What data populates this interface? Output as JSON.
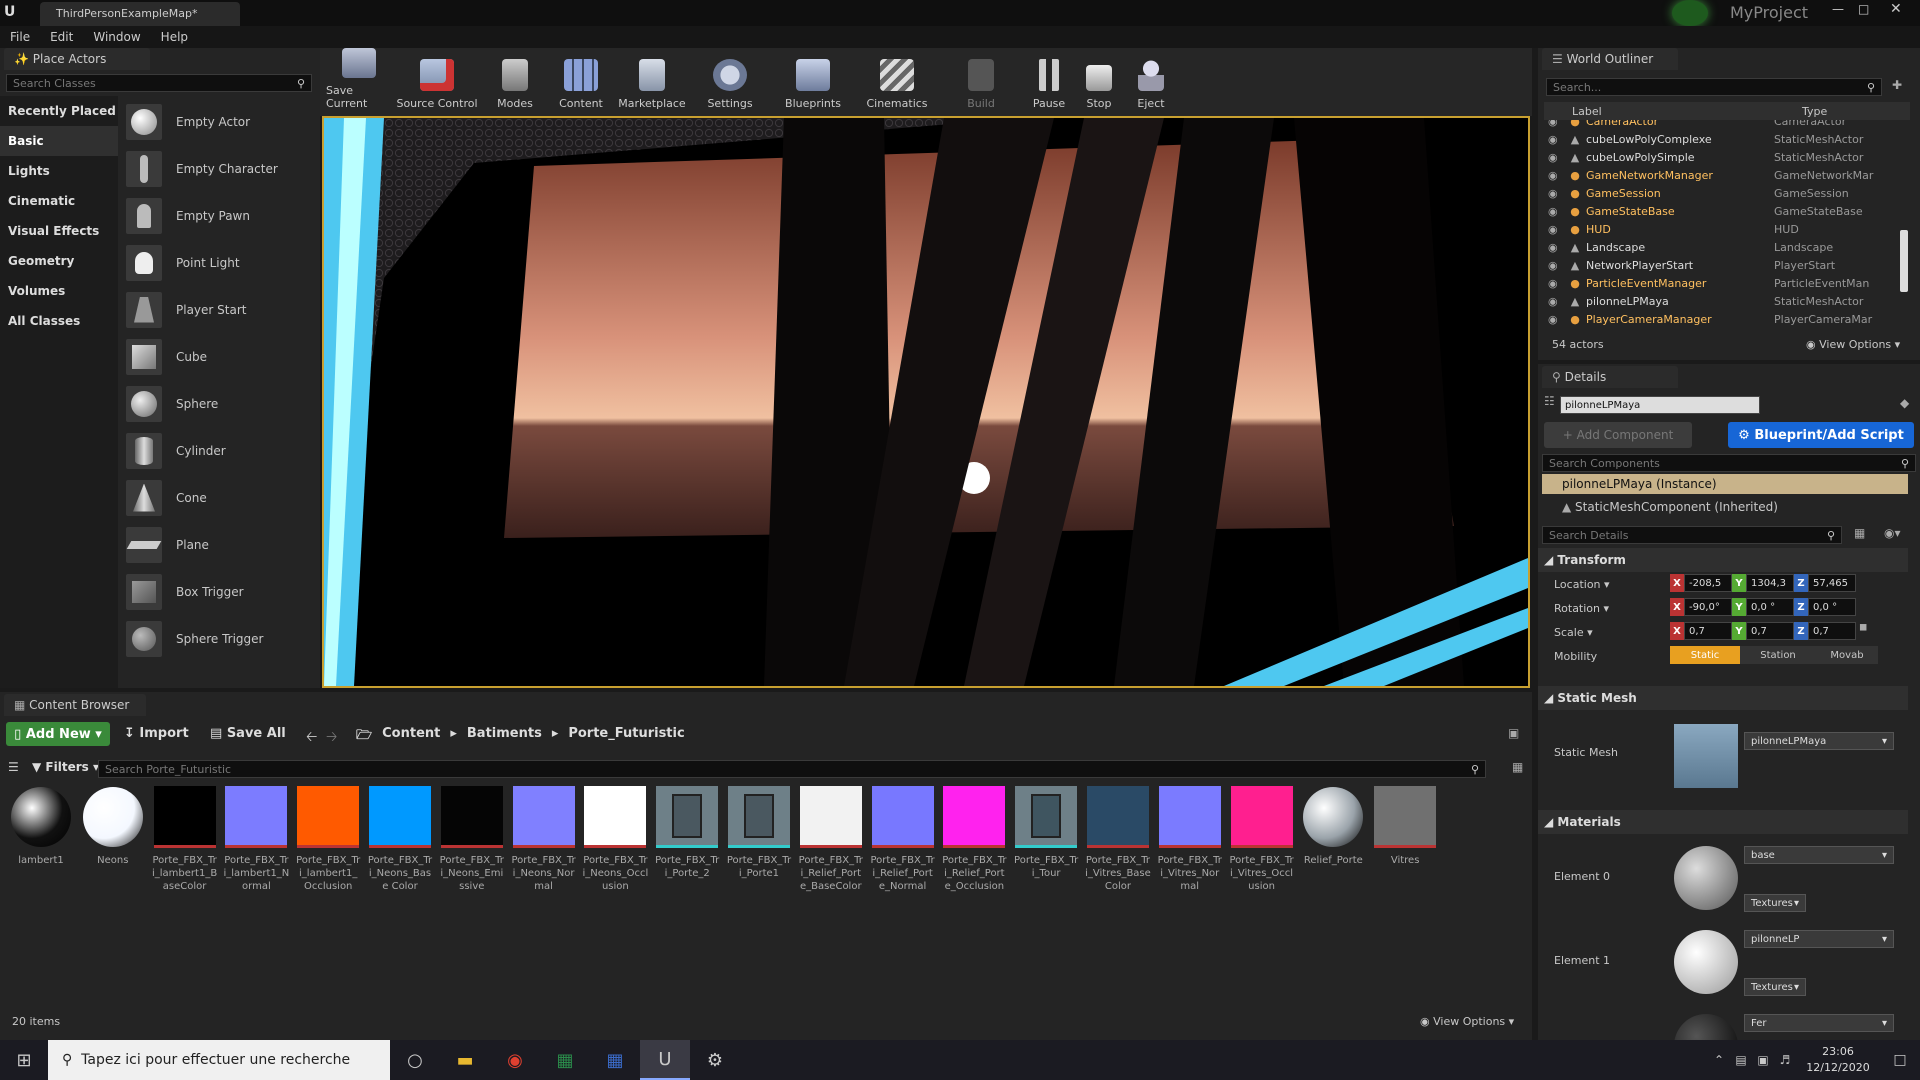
{
  "window": {
    "tab_title": "ThirdPersonExampleMap*",
    "project": "MyProject"
  },
  "menu": [
    "File",
    "Edit",
    "Window",
    "Help"
  ],
  "place_actors": {
    "tab": "Place Actors",
    "search_placeholder": "Search Classes",
    "categories": [
      "Recently Placed",
      "Basic",
      "Lights",
      "Cinematic",
      "Visual Effects",
      "Geometry",
      "Volumes",
      "All Classes"
    ],
    "active_category": "Basic",
    "items": [
      "Empty Actor",
      "Empty Character",
      "Empty Pawn",
      "Point Light",
      "Player Start",
      "Cube",
      "Sphere",
      "Cylinder",
      "Cone",
      "Plane",
      "Box Trigger",
      "Sphere Trigger"
    ]
  },
  "toolbar": {
    "buttons": [
      "Save Current",
      "Source Control",
      "Modes",
      "Content",
      "Marketplace",
      "Settings",
      "Blueprints",
      "Cinematics",
      "Build",
      "Pause",
      "Stop",
      "Eject"
    ]
  },
  "outliner": {
    "tab": "World Outliner",
    "search_placeholder": "Search...",
    "col_label": "Label",
    "col_type": "Type",
    "rows": [
      {
        "label": "CameraActor",
        "type": "CameraActor",
        "highlight": true
      },
      {
        "label": "cubeLowPolyComplexe",
        "type": "StaticMeshActor",
        "highlight": false
      },
      {
        "label": "cubeLowPolySimple",
        "type": "StaticMeshActor",
        "highlight": false
      },
      {
        "label": "GameNetworkManager",
        "type": "GameNetworkMar",
        "highlight": true
      },
      {
        "label": "GameSession",
        "type": "GameSession",
        "highlight": true
      },
      {
        "label": "GameStateBase",
        "type": "GameStateBase",
        "highlight": true
      },
      {
        "label": "HUD",
        "type": "HUD",
        "highlight": true
      },
      {
        "label": "Landscape",
        "type": "Landscape",
        "highlight": false
      },
      {
        "label": "NetworkPlayerStart",
        "type": "PlayerStart",
        "highlight": false
      },
      {
        "label": "ParticleEventManager",
        "type": "ParticleEventMan",
        "highlight": true
      },
      {
        "label": "pilonneLPMaya",
        "type": "StaticMeshActor",
        "highlight": false
      },
      {
        "label": "PlayerCameraManager",
        "type": "PlayerCameraMar",
        "highlight": true
      }
    ],
    "count": "54 actors",
    "view_options": "View Options"
  },
  "details": {
    "tab": "Details",
    "name": "pilonneLPMaya",
    "add_component": "+ Add Component",
    "blueprint_btn": "Blueprint/Add Script",
    "search_components": "Search Components",
    "instance": "pilonneLPMaya (Instance)",
    "component": "StaticMeshComponent (Inherited)",
    "search_details": "Search Details",
    "transform": {
      "title": "Transform",
      "location_label": "Location",
      "rotation_label": "Rotation",
      "scale_label": "Scale",
      "mobility_label": "Mobility",
      "location": [
        "-208,5",
        "1304,3",
        "57,465"
      ],
      "rotation": [
        "-90,0°",
        "0,0 °",
        "0,0 °"
      ],
      "scale": [
        "0,7",
        "0,7",
        "0,7"
      ],
      "mobility": [
        "Static",
        "Station",
        "Movab"
      ]
    },
    "static_mesh": {
      "title": "Static Mesh",
      "label": "Static Mesh",
      "value": "pilonneLPMaya"
    },
    "materials": {
      "title": "Materials",
      "elements": [
        {
          "label": "Element 0",
          "value": "base",
          "sub": "Textures"
        },
        {
          "label": "Element 1",
          "value": "pilonneLP",
          "sub": "Textures"
        },
        {
          "label": "",
          "value": "Fer",
          "sub": ""
        }
      ]
    }
  },
  "content_browser": {
    "tab": "Content Browser",
    "add_new": "Add New",
    "import": "Import",
    "save_all": "Save All",
    "path": [
      "Content",
      "Batiments",
      "Porte_Futuristic"
    ],
    "filters": "Filters",
    "search_placeholder": "Search Porte_Futuristic",
    "item_count": "20 items",
    "view_options": "View Options",
    "assets": [
      {
        "name": "lambert1",
        "color": "#111111",
        "shape": "sphere"
      },
      {
        "name": "Neons",
        "color": "#f4f8ff",
        "shape": "sphere"
      },
      {
        "name": "Porte_FBX_Tri_lambert1_BaseColor",
        "color": "#000000",
        "shape": "tex"
      },
      {
        "name": "Porte_FBX_Tri_lambert1_Normal",
        "color": "#7c7cff",
        "shape": "tex"
      },
      {
        "name": "Porte_FBX_Tri_lambert1_Occlusion",
        "color": "#ff5a00",
        "shape": "tex"
      },
      {
        "name": "Porte_FBX_Tri_Neons_Base Color",
        "color": "#0099ff",
        "shape": "tex"
      },
      {
        "name": "Porte_FBX_Tri_Neons_Emissive",
        "color": "#050505",
        "shape": "tex"
      },
      {
        "name": "Porte_FBX_Tri_Neons_Normal",
        "color": "#8080ff",
        "shape": "tex"
      },
      {
        "name": "Porte_FBX_Tri_Neons_Occlusion",
        "color": "#ffffff",
        "shape": "tex"
      },
      {
        "name": "Porte_FBX_Tri_Porte_2",
        "color": "#4a5860",
        "shape": "mesh"
      },
      {
        "name": "Porte_FBX_Tri_Porte1",
        "color": "#4a5860",
        "shape": "mesh"
      },
      {
        "name": "Porte_FBX_Tri_Relief_Porte_BaseColor",
        "color": "#f2f2f2",
        "shape": "tex"
      },
      {
        "name": "Porte_FBX_Tri_Relief_Porte_Normal",
        "color": "#7878ff",
        "shape": "tex"
      },
      {
        "name": "Porte_FBX_Tri_Relief_Porte_Occlusion",
        "color": "#ff22ee",
        "shape": "tex"
      },
      {
        "name": "Porte_FBX_Tri_Tour",
        "color": "#3f5560",
        "shape": "mesh"
      },
      {
        "name": "Porte_FBX_Tri_Vitres_Base Color",
        "color": "#2a4a66",
        "shape": "tex"
      },
      {
        "name": "Porte_FBX_Tri_Vitres_Normal",
        "color": "#7b7bff",
        "shape": "tex"
      },
      {
        "name": "Porte_FBX_Tri_Vitres_Occlusion",
        "color": "#ff1f8f",
        "shape": "tex"
      },
      {
        "name": "Relief_Porte",
        "color": "#9aa3aa",
        "shape": "sphere"
      },
      {
        "name": "Vitres",
        "color": "#707070",
        "shape": "tex"
      }
    ]
  },
  "taskbar": {
    "search_placeholder": "Tapez ici pour effectuer une recherche",
    "time": "23:06",
    "date": "12/12/2020"
  }
}
